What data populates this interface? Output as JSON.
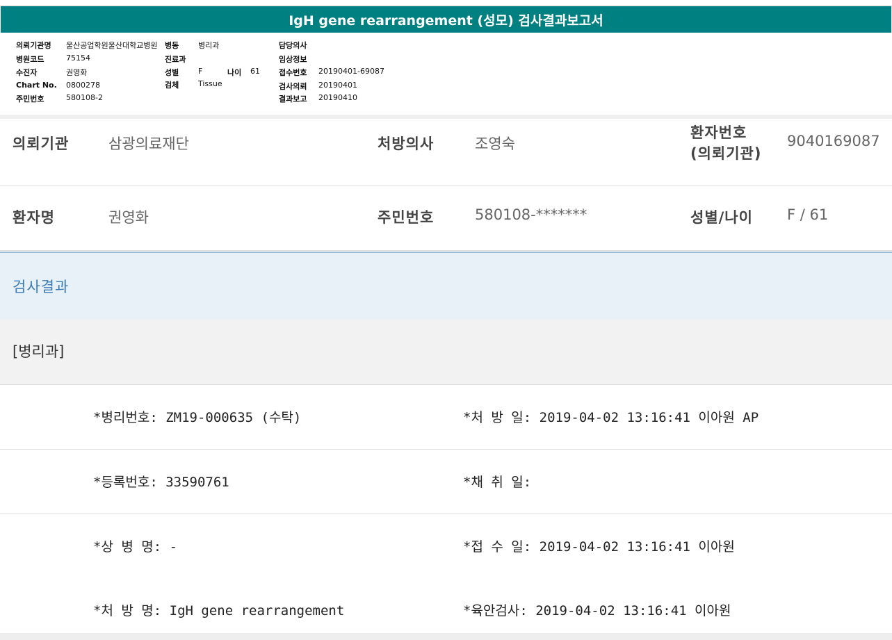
{
  "report": {
    "title": "IgH gene rearrangement (성모) 검사결과보고서"
  },
  "header_info": {
    "institution_label": "의뢰기관명",
    "institution_value": "울산공업학원울산대학교병원",
    "ward_label": "병동",
    "ward_value": "병리과",
    "attending_label": "담당의사",
    "hospital_code_label": "병원코드",
    "hospital_code_value": "75154",
    "dept_label": "진료과",
    "clinical_info_label": "임상정보",
    "recipient_label": "수진자",
    "recipient_value": "권영화",
    "sex_label": "성별",
    "sex_value": "F",
    "age_label": "나이",
    "age_value": "61",
    "receipt_no_label": "접수번호",
    "receipt_no_value": "20190401-69087",
    "chart_no_label": "Chart No.",
    "chart_no_value": "0800278",
    "specimen_label": "검체",
    "specimen_value": "Tissue",
    "test_request_label": "검사의뢰",
    "test_request_value": "20190401",
    "resident_no_label": "주민번호",
    "resident_no_value": "580108-2",
    "result_report_label": "결과보고",
    "result_report_value": "20190410"
  },
  "patient": {
    "requesting_institution_label": "의뢰기관",
    "requesting_institution_value": "삼광의료재단",
    "prescriber_label": "처방의사",
    "prescriber_value": "조영숙",
    "patient_no_label_line1": "환자번호",
    "patient_no_label_line2": "(의뢰기관)",
    "patient_no_value": "9040169087",
    "name_label": "환자명",
    "name_value": "권영화",
    "resident_no_label": "주민번호",
    "resident_no_value": "580108-*******",
    "sex_age_label": "성별/나이",
    "sex_age_value": "F / 61"
  },
  "results": {
    "section_title": "검사결과",
    "department": "[병리과]",
    "rows": [
      {
        "left": "*병리번호: ZM19-000635 (수탁)",
        "right": "*처 방 일: 2019-04-02 13:16:41  이아원 AP"
      },
      {
        "left": "*등록번호: 33590761",
        "right": "*채 취 일:"
      },
      {
        "left": "*상 병 명: -",
        "right": "*접 수 일: 2019-04-02 13:16:41  이아원"
      },
      {
        "left": "*처 방 명: IgH gene rearrangement",
        "right": "*육안검사: 2019-04-02 13:16:41  이아원"
      }
    ]
  }
}
